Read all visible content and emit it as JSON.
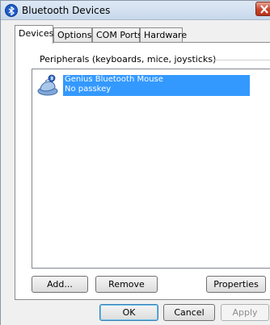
{
  "window": {
    "title": "Bluetooth Devices"
  },
  "tabs": [
    {
      "label": "Devices"
    },
    {
      "label": "Options"
    },
    {
      "label": "COM Ports"
    },
    {
      "label": "Hardware"
    }
  ],
  "group": {
    "label": "Peripherals (keyboards, mice, joysticks)"
  },
  "devices": [
    {
      "name": "Genius Bluetooth Mouse",
      "status": "No passkey"
    }
  ],
  "panel_buttons": {
    "add": "Add...",
    "remove": "Remove",
    "properties": "Properties"
  },
  "dialog_buttons": {
    "ok": "OK",
    "cancel": "Cancel",
    "apply": "Apply"
  },
  "colors": {
    "selection": "#3399ff",
    "close_button": "#c7432c",
    "bluetooth_badge": "#1d5bc9"
  },
  "icons": {
    "title": "bluetooth-icon",
    "device": "mouse-icon",
    "close": "close-icon"
  }
}
